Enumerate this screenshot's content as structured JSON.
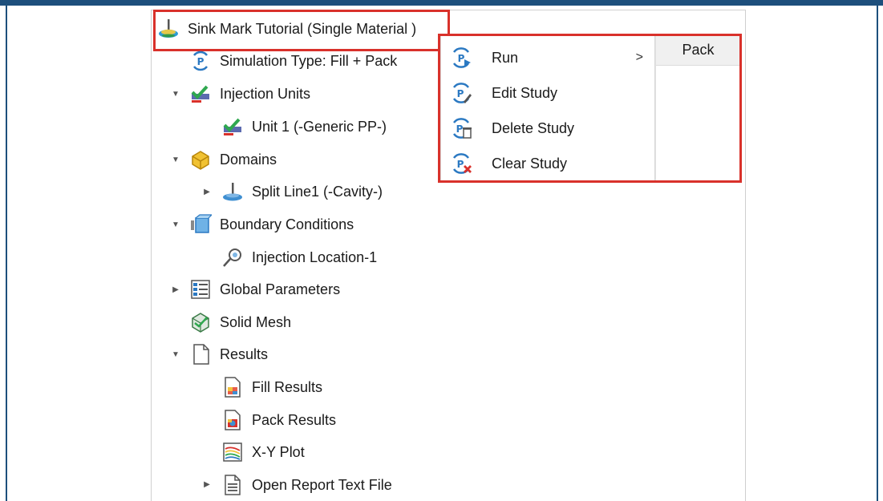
{
  "tree": {
    "root": {
      "label": "Sink Mark Tutorial (Single Material )",
      "icon": "study-icon"
    },
    "items": [
      {
        "label": "Simulation Type: Fill + Pack",
        "icon": "simulation-type-icon"
      },
      {
        "label": "Injection Units",
        "icon": "injection-units-icon",
        "expanded": true
      },
      {
        "label": "Unit 1 (-Generic PP-)",
        "icon": "injection-unit-icon"
      },
      {
        "label": "Domains",
        "icon": "domains-icon",
        "expanded": true
      },
      {
        "label": "Split Line1 (-Cavity-)",
        "icon": "split-line-icon",
        "expanded": false
      },
      {
        "label": "Boundary Conditions",
        "icon": "boundary-conditions-icon",
        "expanded": true
      },
      {
        "label": "Injection Location-1",
        "icon": "injection-location-icon"
      },
      {
        "label": "Global Parameters",
        "icon": "global-parameters-icon",
        "expanded": false
      },
      {
        "label": "Solid Mesh",
        "icon": "solid-mesh-icon"
      },
      {
        "label": "Results",
        "icon": "results-icon",
        "expanded": true
      },
      {
        "label": "Fill Results",
        "icon": "fill-results-icon"
      },
      {
        "label": "Pack Results",
        "icon": "pack-results-icon"
      },
      {
        "label": "X-Y Plot",
        "icon": "xy-plot-icon"
      },
      {
        "label": "Open Report Text File",
        "icon": "report-file-icon",
        "expanded": false
      }
    ]
  },
  "context_menu": {
    "items": [
      {
        "label": "Run",
        "icon": "run-study-icon",
        "submenu_arrow": ">"
      },
      {
        "label": "Edit Study",
        "icon": "edit-study-icon"
      },
      {
        "label": "Delete Study",
        "icon": "delete-study-icon"
      },
      {
        "label": "Clear Study",
        "icon": "clear-study-icon"
      }
    ],
    "submenu": {
      "items": [
        {
          "label": "Pack"
        }
      ]
    }
  },
  "colors": {
    "highlight": "#d9312b",
    "frame": "#1d4f7c",
    "accent_blue": "#2b79c2"
  }
}
